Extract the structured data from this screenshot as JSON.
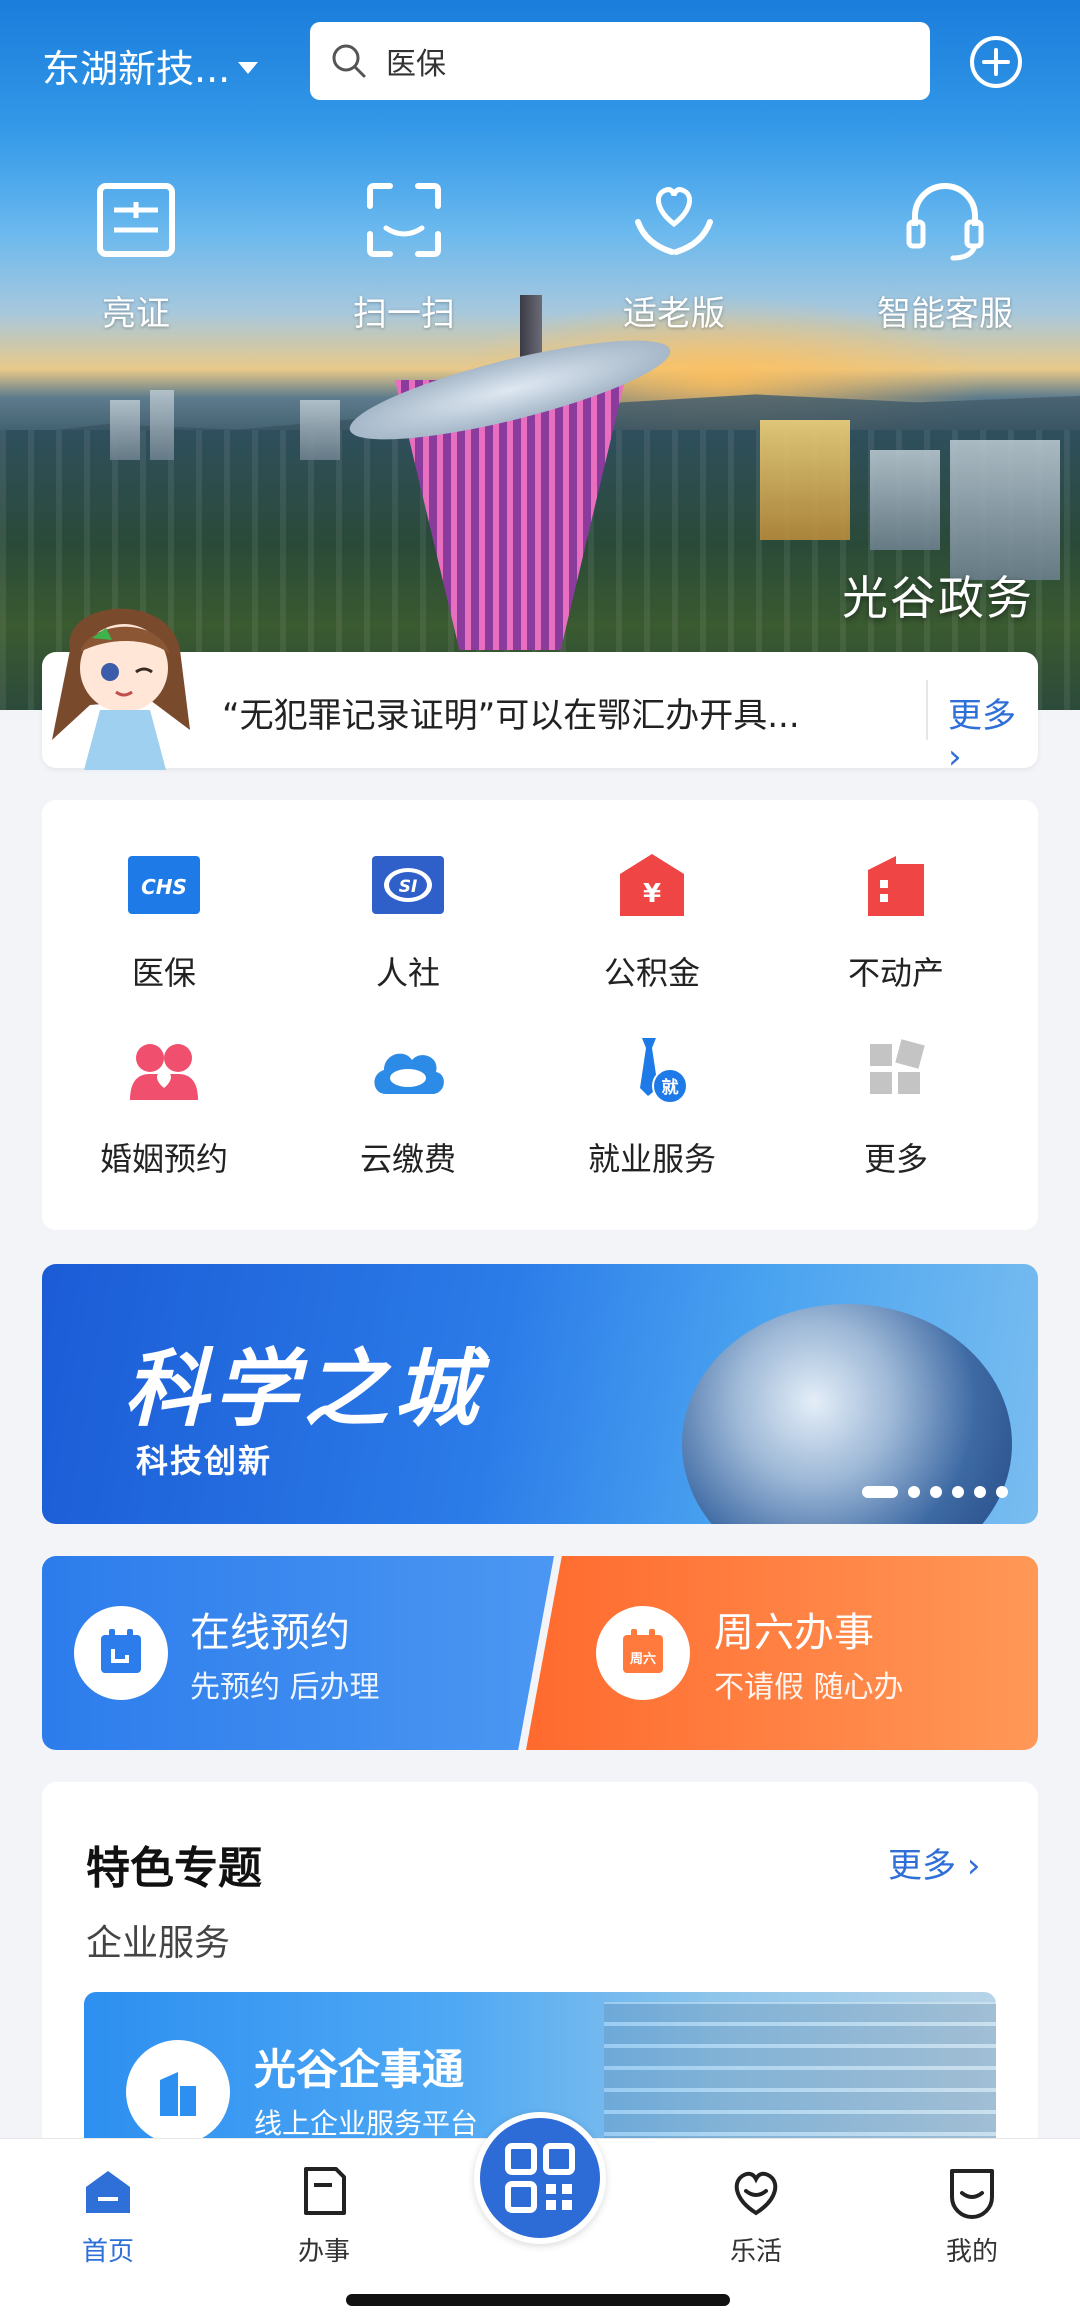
{
  "header": {
    "location": "东湖新技...",
    "search_placeholder": "医保"
  },
  "quick_actions": [
    {
      "label": "亮证",
      "icon": "id-card-icon"
    },
    {
      "label": "扫一扫",
      "icon": "scan-icon"
    },
    {
      "label": "适老版",
      "icon": "heart-hands-icon"
    },
    {
      "label": "智能客服",
      "icon": "headset-icon"
    }
  ],
  "hero": {
    "brand": "光谷政务"
  },
  "notice": {
    "text": "“无犯罪记录证明”可以在鄂汇办开具...",
    "more": "更多"
  },
  "services": [
    {
      "label": "医保",
      "icon": "chs-icon",
      "color": "#1e7ae6"
    },
    {
      "label": "人社",
      "icon": "social-security-icon",
      "color": "#2f5fc8"
    },
    {
      "label": "公积金",
      "icon": "housing-fund-icon",
      "color": "#ef4545"
    },
    {
      "label": "不动产",
      "icon": "real-estate-icon",
      "color": "#ef4545"
    },
    {
      "label": "婚姻预约",
      "icon": "marriage-icon",
      "color": "#f0506e"
    },
    {
      "label": "云缴费",
      "icon": "cloud-payment-icon",
      "color": "#2b8be6"
    },
    {
      "label": "就业服务",
      "icon": "employment-icon",
      "color": "#1e7ae6"
    },
    {
      "label": "更多",
      "icon": "more-grid-icon",
      "color": "#bdbdbd"
    }
  ],
  "banner": {
    "title": "科学之城",
    "subtitle": "科技创新"
  },
  "cards": {
    "left": {
      "title": "在线预约",
      "subtitle": "先预约 后办理"
    },
    "right": {
      "title": "周六办事",
      "subtitle": "不请假 随心办",
      "icon_text": "周六"
    }
  },
  "featured": {
    "heading": "特色专题",
    "more": "更多",
    "category": "企业服务",
    "promo_title": "光谷企事通",
    "promo_subtitle": "线上企业服务平台"
  },
  "bottom_nav": [
    {
      "label": "首页",
      "icon": "home-icon",
      "active": true
    },
    {
      "label": "办事",
      "icon": "document-icon",
      "active": false
    },
    {
      "label": "乐活",
      "icon": "heart-smile-icon",
      "active": false
    },
    {
      "label": "我的",
      "icon": "face-icon",
      "active": false
    }
  ],
  "colors": {
    "accent": "#2f6fd8",
    "orange": "#ff7a3c"
  }
}
